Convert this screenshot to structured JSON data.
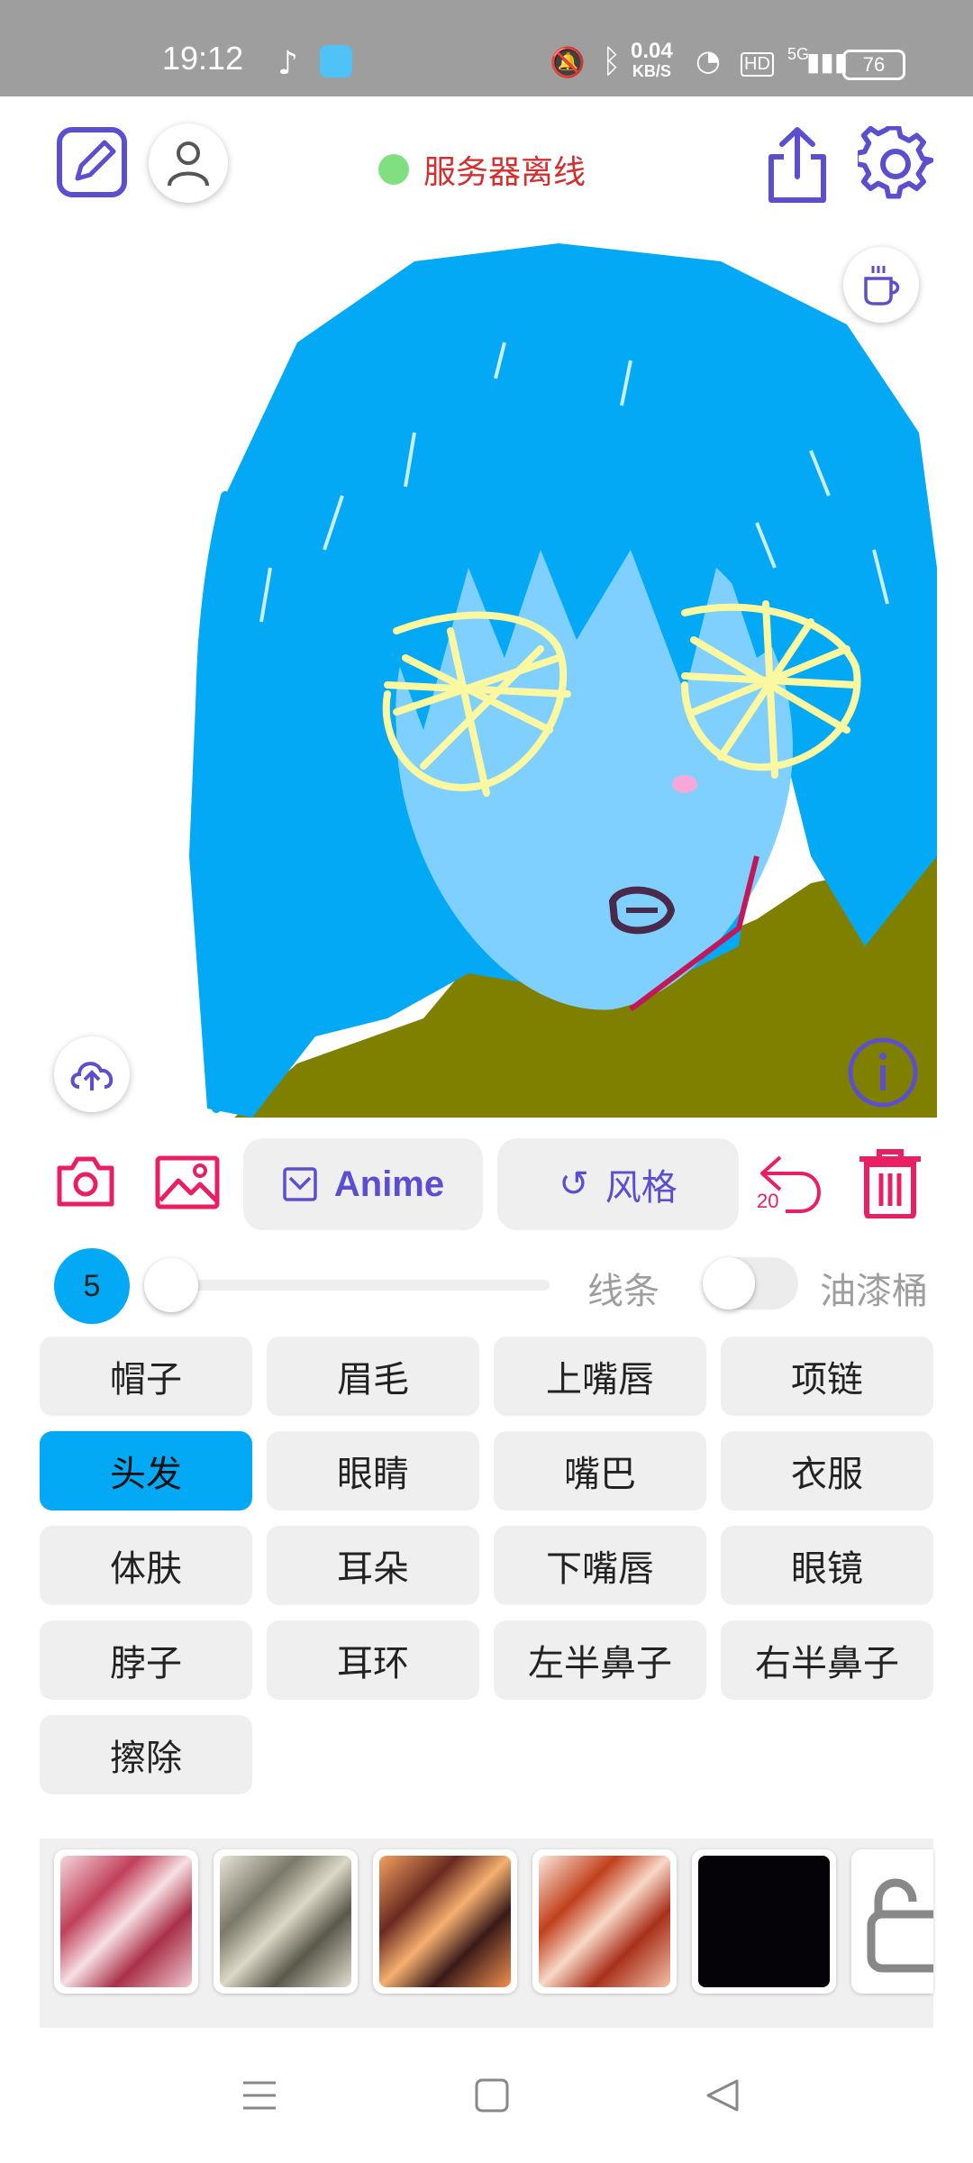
{
  "status_bar": {
    "time": "19:12",
    "net_speed": "0.04",
    "net_unit": "KB/S",
    "hd": "HD",
    "signal": "5G",
    "battery": "76"
  },
  "top_bar": {
    "server_status": "服务器离线",
    "server_status_color": "#80e080"
  },
  "tool_row": {
    "anime_label": "Anime",
    "style_label": "风格",
    "undo_count": "20"
  },
  "brush": {
    "size": "5",
    "line_label": "线条",
    "bucket_label": "油漆桶",
    "bucket_on": false
  },
  "parts": [
    "帽子",
    "眉毛",
    "上嘴唇",
    "项链",
    "头发",
    "眼睛",
    "嘴巴",
    "衣服",
    "体肤",
    "耳朵",
    "下嘴唇",
    "眼镜",
    "脖子",
    "耳环",
    "左半鼻子",
    "右半鼻子",
    "擦除"
  ],
  "active_part": "头发",
  "colors": {
    "accent": "#5b4fcf",
    "danger": "#e91e63",
    "hair": "#03a9f4",
    "skin": "#80d0ff",
    "eyes": "#fcf8a0",
    "clothes": "#808000"
  },
  "textures": [
    "pink-marble",
    "grey-marble",
    "orange-swirl",
    "red-swirl",
    "black",
    "locked"
  ]
}
